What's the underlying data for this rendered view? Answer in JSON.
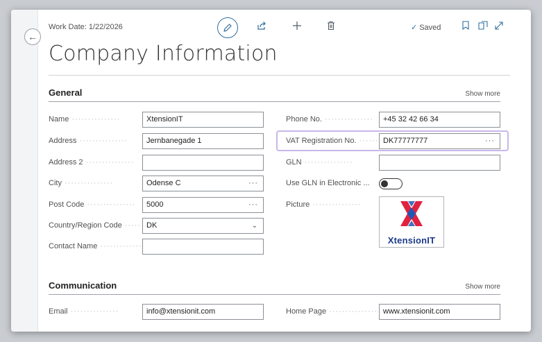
{
  "header": {
    "work_date": "Work Date: 1/22/2026",
    "status": "Saved"
  },
  "page": {
    "title": "Company Information"
  },
  "general": {
    "title": "General",
    "show_more": "Show more",
    "name_label": "Name",
    "name_value": "XtensionIT",
    "address_label": "Address",
    "address_value": "Jernbanegade 1",
    "address2_label": "Address 2",
    "address2_value": "",
    "city_label": "City",
    "city_value": "Odense C",
    "postcode_label": "Post Code",
    "postcode_value": "5000",
    "country_label": "Country/Region Code",
    "country_value": "DK",
    "contact_label": "Contact Name",
    "contact_value": "",
    "phone_label": "Phone No.",
    "phone_value": "+45 32 42 66 34",
    "vat_label": "VAT Registration No.",
    "vat_value": "DK77777777",
    "gln_label": "GLN",
    "gln_value": "",
    "use_gln_label": "Use GLN in Electronic ...",
    "use_gln_on": false,
    "picture_label": "Picture",
    "logo_text": "XtensionIT"
  },
  "communication": {
    "title": "Communication",
    "show_more": "Show more",
    "email_label": "Email",
    "email_value": "info@xtensionit.com",
    "homepage_label": "Home Page",
    "homepage_value": "www.xtensionit.com"
  },
  "colors": {
    "accent": "#2e6f9e",
    "focus_ring": "#c8b6ea",
    "logo_red": "#e0223f",
    "logo_blue": "#1b58b8"
  },
  "icons": [
    "back-arrow-icon",
    "edit-pencil-icon",
    "share-icon",
    "plus-icon",
    "trash-icon",
    "checkmark-icon",
    "bookmark-icon",
    "open-new-window-icon",
    "expand-icon",
    "ellipsis-icon",
    "chevron-down-icon"
  ]
}
